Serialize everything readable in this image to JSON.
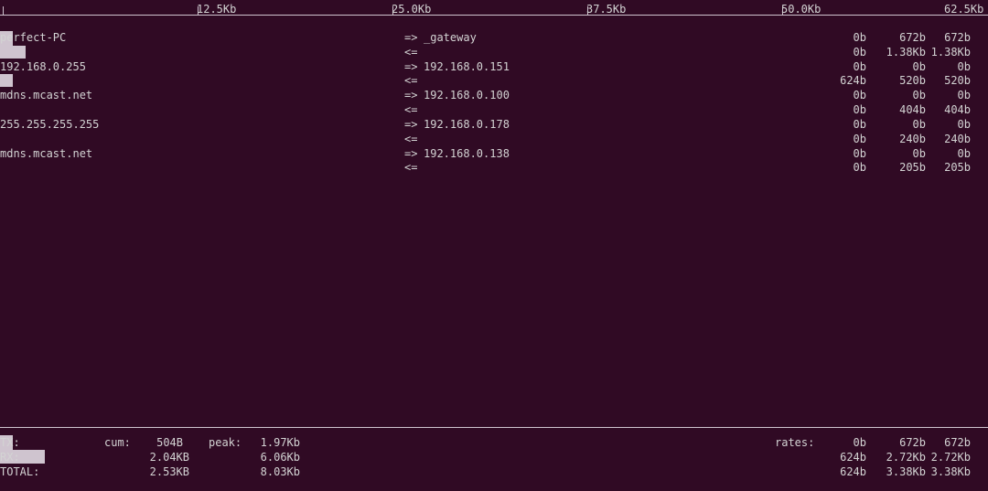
{
  "scale": {
    "ticks": [
      "12.5Kb",
      "25.0Kb",
      "37.5Kb",
      "50.0Kb",
      "62.5Kb"
    ]
  },
  "arrows": {
    "out": "=>",
    "in": "<="
  },
  "flows": [
    {
      "host": "perfect-PC",
      "peer": "_gateway",
      "tx": [
        "0b",
        "672b",
        "672b"
      ],
      "rx": [
        "0b",
        "1.38Kb",
        "1.38Kb"
      ],
      "tx_bar_pct": 0,
      "rx_bar_pct": 2.2
    },
    {
      "host": "192.168.0.255",
      "peer": "192.168.0.151",
      "tx": [
        "0b",
        "0b",
        "0b"
      ],
      "rx": [
        "624b",
        "520b",
        "520b"
      ],
      "tx_bar_pct": 0,
      "rx_bar_pct": 0.8
    },
    {
      "host": "mdns.mcast.net",
      "peer": "192.168.0.100",
      "tx": [
        "0b",
        "0b",
        "0b"
      ],
      "rx": [
        "0b",
        "404b",
        "404b"
      ],
      "tx_bar_pct": 0,
      "rx_bar_pct": 0
    },
    {
      "host": "255.255.255.255",
      "peer": "192.168.0.178",
      "tx": [
        "0b",
        "0b",
        "0b"
      ],
      "rx": [
        "0b",
        "240b",
        "240b"
      ],
      "tx_bar_pct": 0,
      "rx_bar_pct": 0
    },
    {
      "host": "mdns.mcast.net",
      "peer": "192.168.0.138",
      "tx": [
        "0b",
        "0b",
        "0b"
      ],
      "rx": [
        "0b",
        "205b",
        "205b"
      ],
      "tx_bar_pct": 0,
      "rx_bar_pct": 0
    }
  ],
  "totals": {
    "tx": {
      "label": "TX:",
      "cum_label": "cum:",
      "cum": "504B",
      "peak_label": "peak:",
      "peak": "1.97Kb",
      "rates_label": "rates:",
      "rates": [
        "0b",
        "672b",
        "672b"
      ]
    },
    "rx": {
      "label": "RX:",
      "cum": "2.04KB",
      "peak": "6.06Kb",
      "rates": [
        "624b",
        "2.72Kb",
        "2.72Kb"
      ]
    },
    "total": {
      "label": "TOTAL:",
      "cum": "2.53KB",
      "peak": "8.03Kb",
      "rates": [
        "624b",
        "3.38Kb",
        "3.38Kb"
      ]
    }
  },
  "colors": {
    "background": "#300a24",
    "text": "#d3d3d3",
    "bar": "#cfc4cf"
  }
}
